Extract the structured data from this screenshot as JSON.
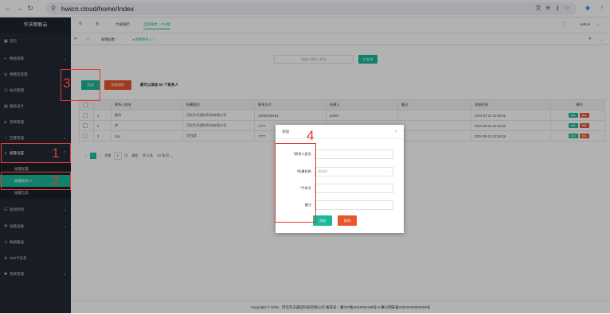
{
  "browser": {
    "url": "hwicn.cloud/home/Index",
    "back_icon": "arrow-left-icon",
    "forward_icon": "arrow-right-icon",
    "reload_icon": "reload-icon"
  },
  "sidebar": {
    "brand": "华沃物联云",
    "items": [
      {
        "label": "首页",
        "icon": "home-icon"
      },
      {
        "label": "数据查看",
        "icon": "chart-icon"
      },
      {
        "label": "物模型管理",
        "icon": "cube-icon"
      },
      {
        "label": "站点管理",
        "icon": "site-icon"
      },
      {
        "label": "报表设计",
        "icon": "report-icon"
      },
      {
        "label": "项目管理",
        "icon": "project-icon"
      },
      {
        "label": "告警管理",
        "icon": "alarm-icon"
      },
      {
        "label": "报警设置",
        "icon": "bell-icon"
      },
      {
        "label": "报警配置"
      },
      {
        "label": "报警联系人"
      },
      {
        "label": "报警信息"
      },
      {
        "label": "驱动控制",
        "icon": "drive-icon"
      },
      {
        "label": "设备运维",
        "icon": "wrench-icon"
      },
      {
        "label": "数据推送",
        "icon": "send-icon"
      },
      {
        "label": "SIM卡信息",
        "icon": "sim-icon"
      },
      {
        "label": "系统管理",
        "icon": "gear-icon"
      }
    ]
  },
  "topbar": {
    "big_screen": "大屏展示",
    "version": "当前版本：Pro版",
    "user": "admin"
  },
  "tabs": {
    "items": [
      "报警配置",
      "报警联系人"
    ]
  },
  "search": {
    "placeholder": "请输入联系人姓名",
    "button": "Q 查询"
  },
  "toolbar": {
    "add": "添加",
    "batch_delete": "批量删除",
    "hint": "最可以添加 50 个联系人"
  },
  "table": {
    "headers": [
      "联系人姓名",
      "所属组织",
      "联系方式",
      "创建人",
      "备注",
      "添加时间",
      "操作"
    ],
    "rows": [
      {
        "no": "1",
        "name": "唐沛",
        "org": "河北华沃通信科技有限公司",
        "phone": "18330189161",
        "creator": "admin",
        "remark": "",
        "time": "2023-07-10 10:05:01"
      },
      {
        "no": "2",
        "name": "李",
        "org": "河北华沃通信科技有限公司",
        "phone": "1777",
        "creator": "",
        "remark": "",
        "time": "2023-09-18 16:26:36"
      },
      {
        "no": "3",
        "name": "zsq",
        "org": "项目部",
        "phone": "1777",
        "creator": "",
        "remark": "",
        "time": "2024-06-13 10:39:29"
      }
    ],
    "edit_label": "编辑",
    "delete_label": "删除"
  },
  "pagination": {
    "current": "1",
    "goto_prefix": "到第",
    "page_input": "1",
    "page_suffix": "页",
    "confirm": "确定",
    "total": "共 3 条",
    "page_size": "10 条/页"
  },
  "footer": {
    "text": "Copyright © 2015 - 河北华沃通信科技有限公司 备案号：冀ICP备2024093138号-5  冀公网安备13010402003259号"
  },
  "modal": {
    "title": "添加",
    "fields": [
      {
        "label": "*联系人姓名",
        "placeholder": ""
      },
      {
        "label": "*所属机构",
        "placeholder": "请选择"
      },
      {
        "label": "*手机号",
        "placeholder": ""
      },
      {
        "label": "备注",
        "placeholder": ""
      }
    ],
    "confirm": "添加",
    "cancel": "取消"
  },
  "annotations": [
    "1",
    "2",
    "3",
    "4"
  ],
  "colors": {
    "primary": "#19b99a",
    "danger": "#e8542c",
    "sidebar_bg": "#232a36",
    "annotation": "#e53935"
  }
}
